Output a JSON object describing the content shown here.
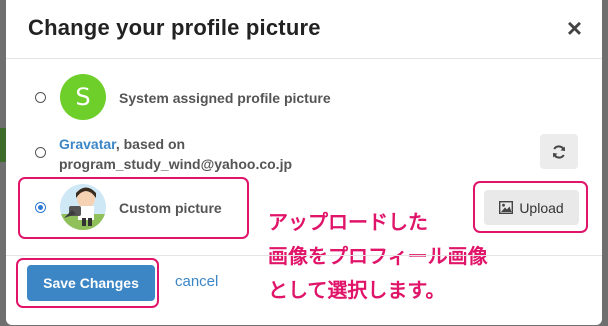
{
  "dialog": {
    "title": "Change your profile picture",
    "close_icon": "close-icon"
  },
  "options": [
    {
      "avatar_letter": "S",
      "avatar_color": "#6fcf2a",
      "label": "System assigned profile picture",
      "selected": false
    },
    {
      "link_text": "Gravatar",
      "label_rest": ", based on",
      "email": "program_study_wind@yahoo.co.jp",
      "refresh_icon": "refresh-icon",
      "selected": false
    },
    {
      "label": "Custom picture",
      "selected": true
    }
  ],
  "upload_button": {
    "label": "Upload",
    "icon": "image-icon"
  },
  "footer": {
    "save_label": "Save Changes",
    "cancel_label": "cancel"
  },
  "annotation": {
    "lines": [
      "アップロードした",
      "画像をプロフィール画像",
      "として選択します。"
    ],
    "color": "#e0156a"
  }
}
